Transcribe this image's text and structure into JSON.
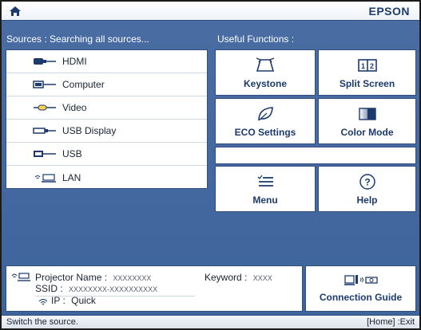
{
  "header": {
    "brand": "EPSON",
    "home_icon": "home-icon"
  },
  "sources": {
    "title": "Sources : Searching all sources...",
    "items": [
      {
        "label": "HDMI",
        "icon": "hdmi-port-icon"
      },
      {
        "label": "Computer",
        "icon": "computer-port-icon"
      },
      {
        "label": "Video",
        "icon": "video-port-icon"
      },
      {
        "label": "USB Display",
        "icon": "usb-display-icon"
      },
      {
        "label": "USB",
        "icon": "usb-port-icon"
      },
      {
        "label": "LAN",
        "icon": "lan-icon"
      }
    ]
  },
  "functions": {
    "title": "Useful Functions :",
    "items": [
      {
        "label": "Keystone",
        "icon": "keystone-icon"
      },
      {
        "label": "Split Screen",
        "icon": "split-screen-icon"
      },
      {
        "label": "ECO Settings",
        "icon": "eco-leaf-icon"
      },
      {
        "label": "Color Mode",
        "icon": "color-mode-icon"
      },
      {
        "label": "Menu",
        "icon": "menu-icon"
      },
      {
        "label": "Help",
        "icon": "help-icon"
      }
    ]
  },
  "info": {
    "projector_label": "Projector Name :",
    "projector_value": "XXXXXXXX",
    "keyword_label": "Keyword :",
    "keyword_value": "XXXX",
    "ssid_label": "SSID :",
    "ssid_value": "XXXXXXXX-XXXXXXXXXX",
    "ip_label": "IP :",
    "ip_value": "Quick"
  },
  "connection_guide": {
    "label": "Connection Guide",
    "icon": "connection-guide-icon"
  },
  "status": {
    "left": "Switch the source.",
    "right": "[Home] :Exit"
  }
}
